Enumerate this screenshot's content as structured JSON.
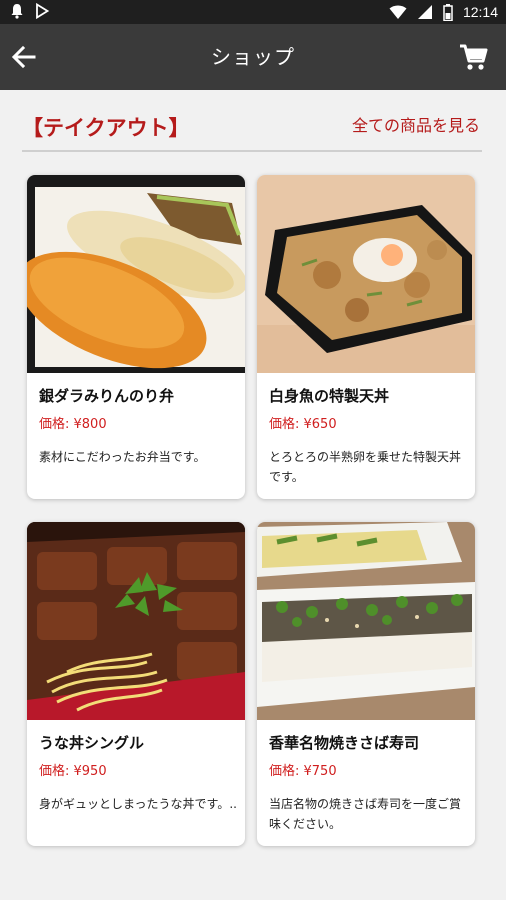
{
  "status_bar": {
    "time": "12:14",
    "icons": [
      "notification-icon",
      "play-store-icon",
      "wifi-icon",
      "signal-icon",
      "battery-icon"
    ]
  },
  "app_bar": {
    "title": "ショップ",
    "back_icon": "arrow-back-icon",
    "cart_icon": "shopping-cart-icon"
  },
  "section": {
    "title": "【テイクアウト】",
    "see_all": "全ての商品を見る"
  },
  "products": [
    {
      "name": "銀ダラみりんのり弁",
      "price": "価格: ¥800",
      "description": "素材にこだわったお弁当です。"
    },
    {
      "name": "白身魚の特製天丼",
      "price": "価格: ¥650",
      "description": "とろとろの半熟卵を乗せた特製天丼です。"
    },
    {
      "name": "うな丼シングル",
      "price": "価格: ¥950",
      "description": "身がギュッとしまったうな丼です。.."
    },
    {
      "name": "香華名物焼きさば寿司",
      "price": "価格: ¥750",
      "description": "当店名物の焼きさば寿司を一度ご賞味ください。"
    }
  ],
  "colors": {
    "accent": "#b51b1b",
    "price": "#d01f1f",
    "app_bar": "#3a3a3a",
    "status_bar": "#1f1f1f"
  }
}
